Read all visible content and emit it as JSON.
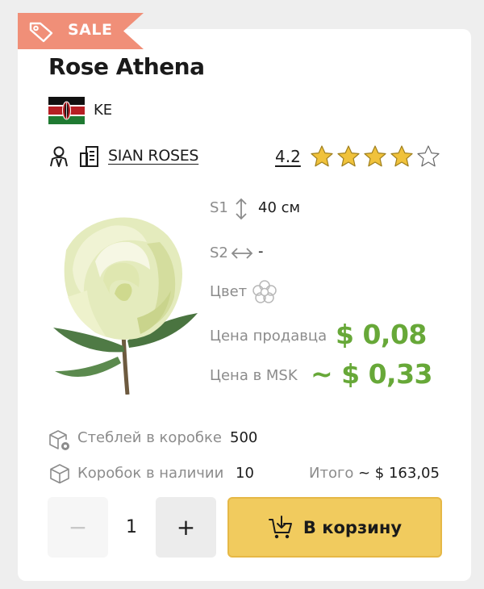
{
  "badge": {
    "label": "SALE"
  },
  "product": {
    "title": "Rose Athena",
    "country_code": "KE",
    "seller_name": "SIAN ROSES",
    "rating": "4.2",
    "rating_stars": 4
  },
  "specs": {
    "s1_label": "S1",
    "s1_value": "40 см",
    "s2_label": "S2",
    "s2_value": "-",
    "color_label": "Цвет"
  },
  "prices": {
    "seller_label": "Цена продавца",
    "seller_value": "$ 0,08",
    "msk_label": "Цена в MSK",
    "msk_value": "~ $ 0,33"
  },
  "stock": {
    "stems_label": "Стеблей в коробке",
    "stems_value": "500",
    "boxes_label": "Коробок в наличии",
    "boxes_value": "10",
    "total_label": "Итого",
    "total_value": "~ $ 163,05"
  },
  "cart": {
    "minus": "−",
    "quantity": "1",
    "plus": "+",
    "button_label": "В корзину"
  },
  "colors": {
    "sale": "#f08f78",
    "price_green": "#67a838",
    "cart_yellow": "#f1cb5e",
    "star_gold": "#f0c23b"
  },
  "icons": [
    "tag-icon",
    "kenya-flag",
    "person-icon",
    "document-icon",
    "star-icon",
    "vertical-arrows-icon",
    "horizontal-arrows-icon",
    "flower-icon",
    "stems-box-icon",
    "box-icon",
    "cart-icon"
  ]
}
